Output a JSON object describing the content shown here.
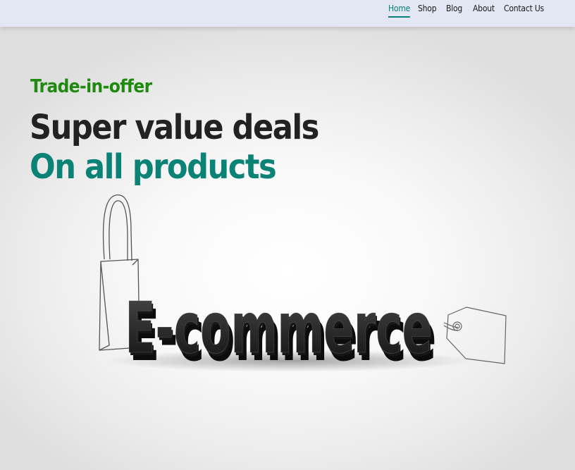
{
  "nav": {
    "items": [
      {
        "label": "Home",
        "active": true
      },
      {
        "label": "Shop",
        "active": false
      },
      {
        "label": "Blog",
        "active": false
      },
      {
        "label": "About",
        "active": false
      },
      {
        "label": "Contact Us",
        "active": false
      }
    ]
  },
  "hero": {
    "tagline": "Trade-in-offer",
    "headline": "Super value deals",
    "subheadline": "On all products",
    "banner_word": "E-commerce"
  },
  "colors": {
    "accent": "#088178",
    "tagline_green": "#1f8a0f",
    "nav_background": "#e3e6f3",
    "headline_dark": "#222222"
  },
  "icons": {
    "bag": "shopping-bag-icon",
    "tag": "price-tag-icon"
  }
}
